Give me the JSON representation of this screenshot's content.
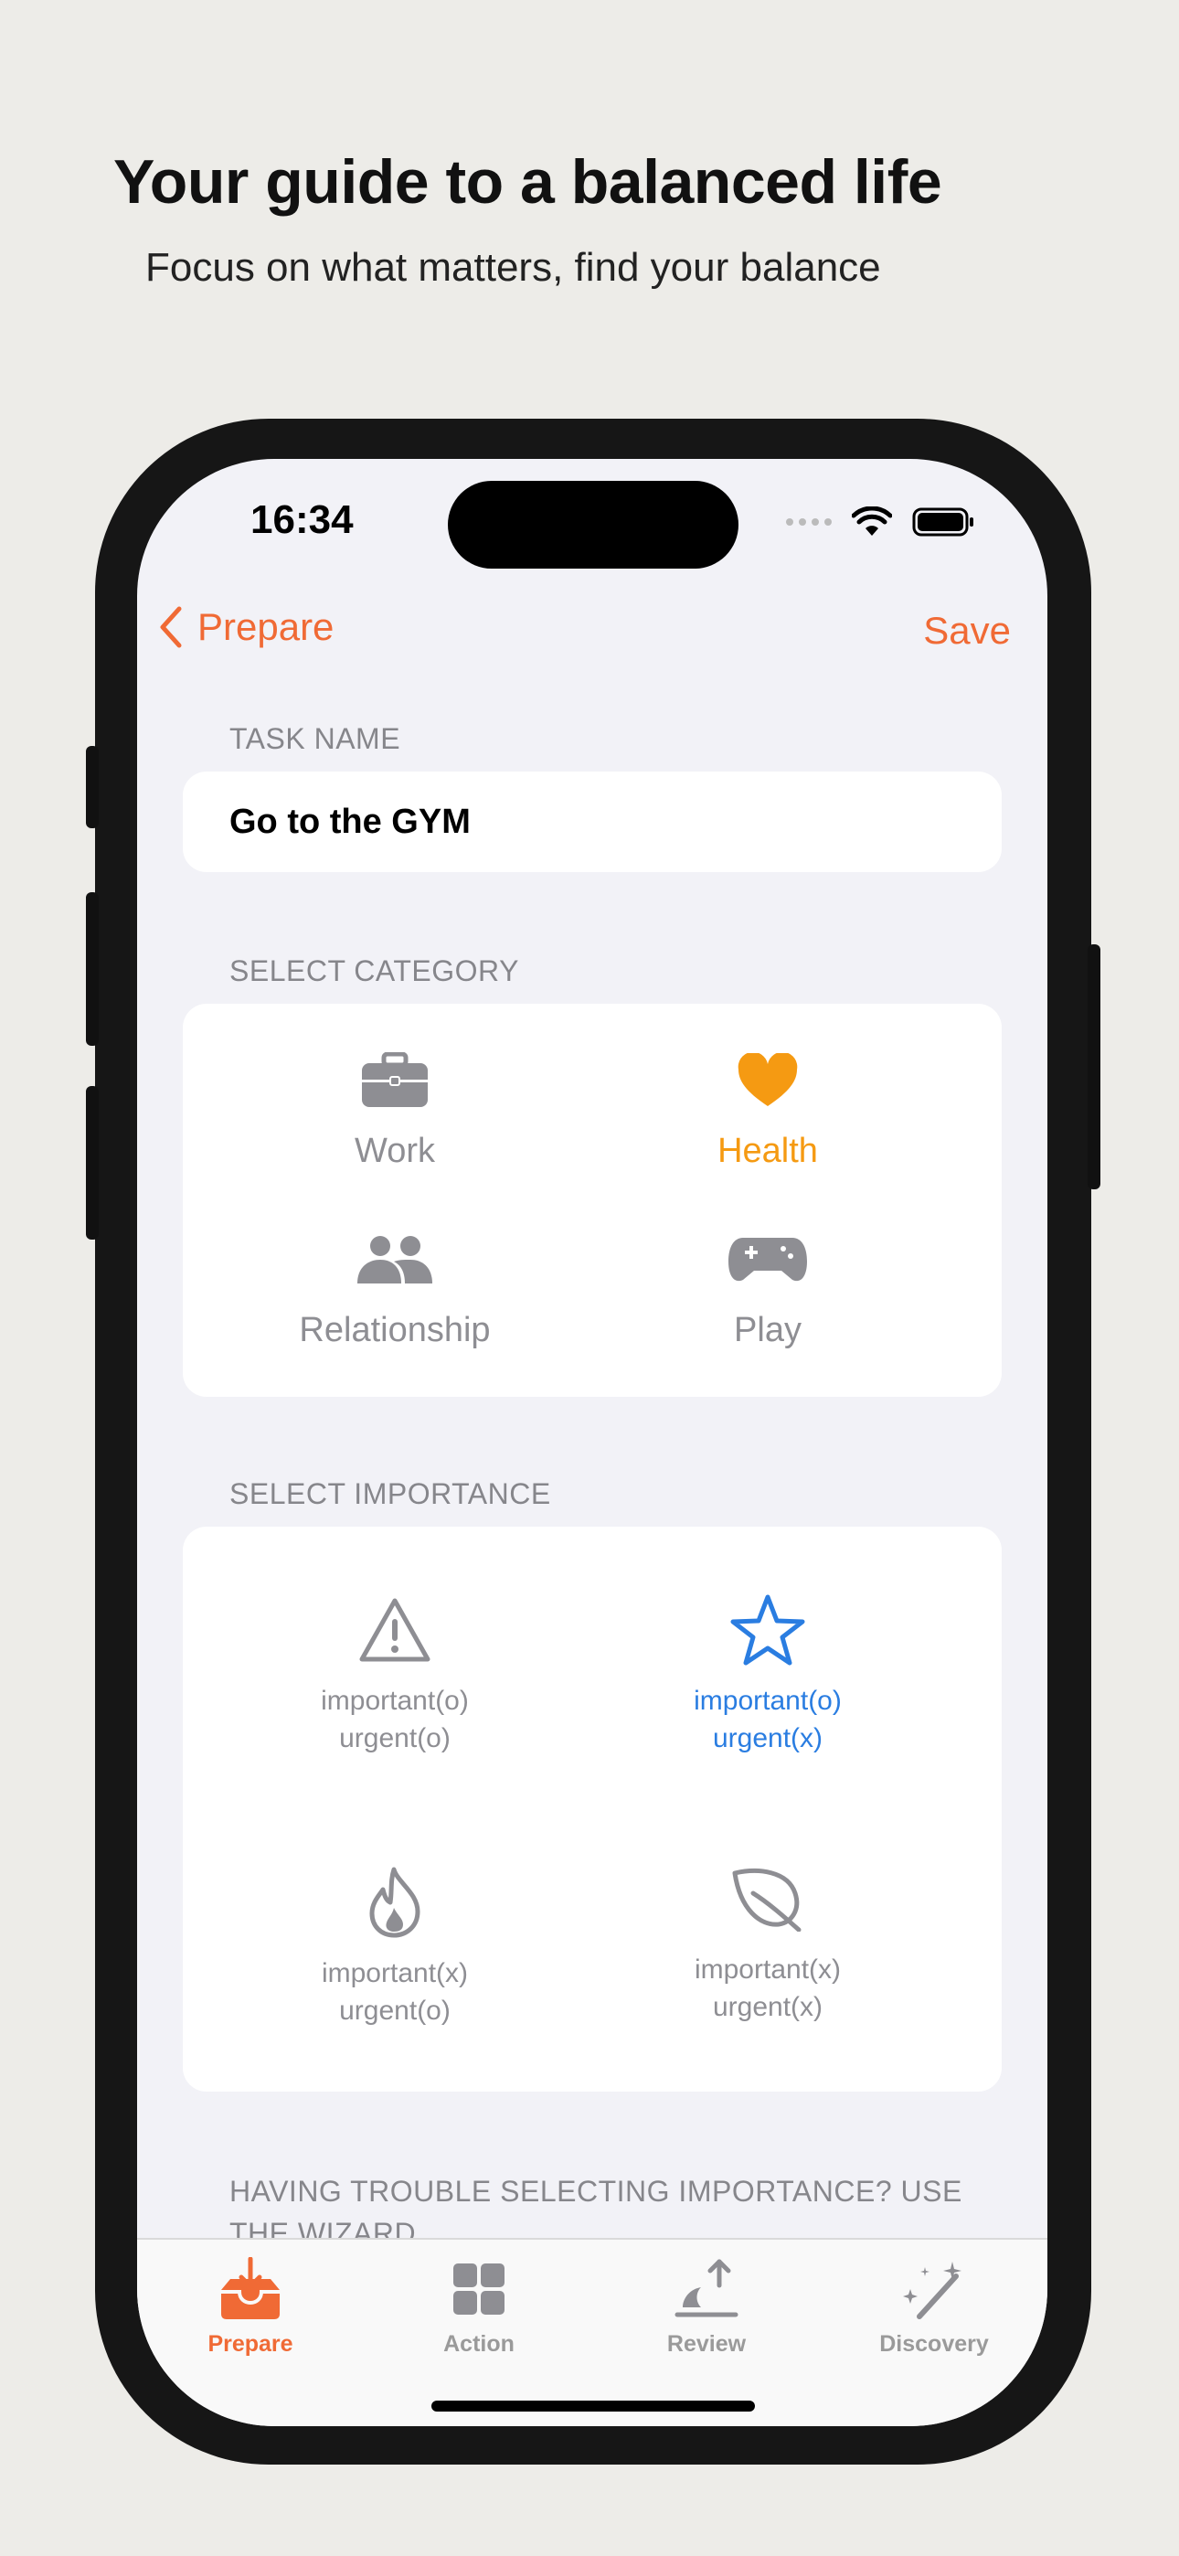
{
  "hero": {
    "title": "Your guide to a balanced life",
    "subtitle": "Focus on what matters, find your balance"
  },
  "status_bar": {
    "time": "16:34"
  },
  "nav": {
    "back_label": "Prepare",
    "save_label": "Save"
  },
  "task": {
    "section_label": "TASK NAME",
    "value": "Go to the GYM"
  },
  "category": {
    "section_label": "SELECT CATEGORY",
    "items": [
      {
        "label": "Work",
        "icon": "briefcase-icon"
      },
      {
        "label": "Health",
        "icon": "heart-icon"
      },
      {
        "label": "Relationship",
        "icon": "people-icon"
      },
      {
        "label": "Play",
        "icon": "gamepad-icon"
      }
    ],
    "selected": "Health"
  },
  "importance": {
    "section_label": "SELECT IMPORTANCE",
    "items": [
      {
        "line1": "important(o)",
        "line2": "urgent(o)",
        "icon": "warning-icon"
      },
      {
        "line1": "important(o)",
        "line2": "urgent(x)",
        "icon": "star-icon"
      },
      {
        "line1": "important(x)",
        "line2": "urgent(o)",
        "icon": "flame-icon"
      },
      {
        "line1": "important(x)",
        "line2": "urgent(x)",
        "icon": "leaf-icon"
      }
    ],
    "selected_index": 1
  },
  "wizard_text": "HAVING TROUBLE SELECTING IMPORTANCE? USE THE WIZARD",
  "tabbar": {
    "tabs": [
      {
        "label": "Prepare",
        "icon": "inbox-icon"
      },
      {
        "label": "Action",
        "icon": "grid-icon"
      },
      {
        "label": "Review",
        "icon": "sunrise-icon"
      },
      {
        "label": "Discovery",
        "icon": "magic-wand-icon"
      }
    ],
    "active": "Prepare"
  },
  "colors": {
    "accent": "#F06A35",
    "health_selected": "#F59A12",
    "importance_selected": "#2A7DE1",
    "inactive": "#8E8E93",
    "background": "#EDECE8"
  }
}
